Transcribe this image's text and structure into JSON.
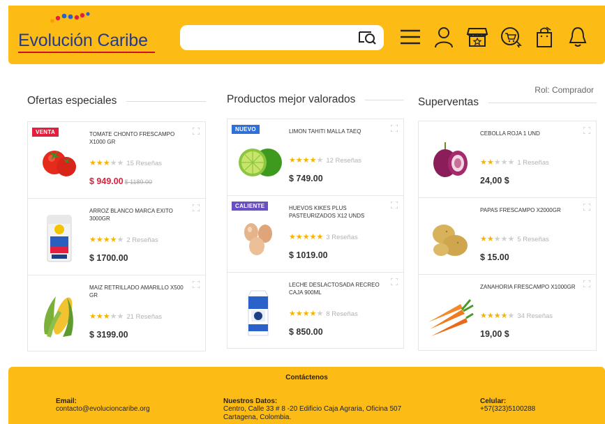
{
  "header": {
    "logo_text": "Evolución Caribe",
    "search_placeholder": "",
    "brand_color": "#fdbc15"
  },
  "role_text": "Rol: Comprador",
  "columns": [
    {
      "title": "Ofertas especiales",
      "products": [
        {
          "badge": "VENTA",
          "badge_color": "#e2203d",
          "name": "TOMATE CHONTO FRESCAMPO X1000 GR",
          "rating": 3,
          "reviews": "15 Reseñas",
          "price": "$ 949.00",
          "old_price": "$ 1189.00",
          "image": "tomato"
        },
        {
          "badge": "",
          "name": "ARROZ BLANCO MARCA EXITO 3000GR",
          "rating": 4,
          "reviews": "2 Reseñas",
          "price": "$ 1700.00",
          "old_price": "",
          "image": "rice-bag"
        },
        {
          "badge": "",
          "name": "MAIZ RETRILLADO AMARILLO X500 GR",
          "rating": 3,
          "reviews": "21 Reseñas",
          "price": "$ 3199.00",
          "old_price": "",
          "image": "corn"
        }
      ]
    },
    {
      "title": "Productos mejor valorados",
      "products": [
        {
          "badge": "NUEVO",
          "badge_color": "#2f6fd6",
          "name": "LIMON TAHITI MALLA TAEQ",
          "rating": 4,
          "reviews": "12 Reseñas",
          "price": "$ 749.00",
          "old_price": "",
          "image": "lime"
        },
        {
          "badge": "CALIENTE",
          "badge_color": "#6a4fc4",
          "name": "HUEVOS KIKES PLUS PASTEURIZADOS X12 UNDS",
          "rating": 5,
          "reviews": "3 Reseñas",
          "price": "$ 1019.00",
          "old_price": "",
          "image": "eggs"
        },
        {
          "badge": "",
          "name": "LECHE DESLACTOSADA RECREO CAJA 900ML",
          "rating": 4,
          "reviews": "8 Reseñas",
          "price": "$ 850.00",
          "old_price": "",
          "image": "milk-box"
        }
      ]
    },
    {
      "title": "Superventas",
      "products": [
        {
          "badge": "",
          "name": "CEBOLLA ROJA 1 UND",
          "rating": 2,
          "reviews": "1 Reseñas",
          "price": "24,00 $",
          "old_price": "",
          "image": "red-onion"
        },
        {
          "badge": "",
          "name": "PAPAS FRESCAMPO X2000GR",
          "rating": 2,
          "reviews": "5 Reseñas",
          "price": "$ 15.00",
          "old_price": "",
          "image": "potato"
        },
        {
          "badge": "",
          "name": "ZANAHORIA FRESCAMPO X1000GR",
          "rating": 4,
          "reviews": "34 Reseñas",
          "price": "19,00 $",
          "old_price": "",
          "image": "carrot"
        }
      ]
    }
  ],
  "footer": {
    "title": "Contáctenos",
    "email_label": "Email:",
    "email_value": "contacto@evolucioncaribe.org",
    "data_label": "Nuestros Datos:",
    "data_value": "Centro, Calle 33 # 8 -20 Edificio Caja Agraria, Oficina 507 Cartagena, Colombia.",
    "phone_label": "Celular:",
    "phone_value": "+57(323)5100288"
  }
}
